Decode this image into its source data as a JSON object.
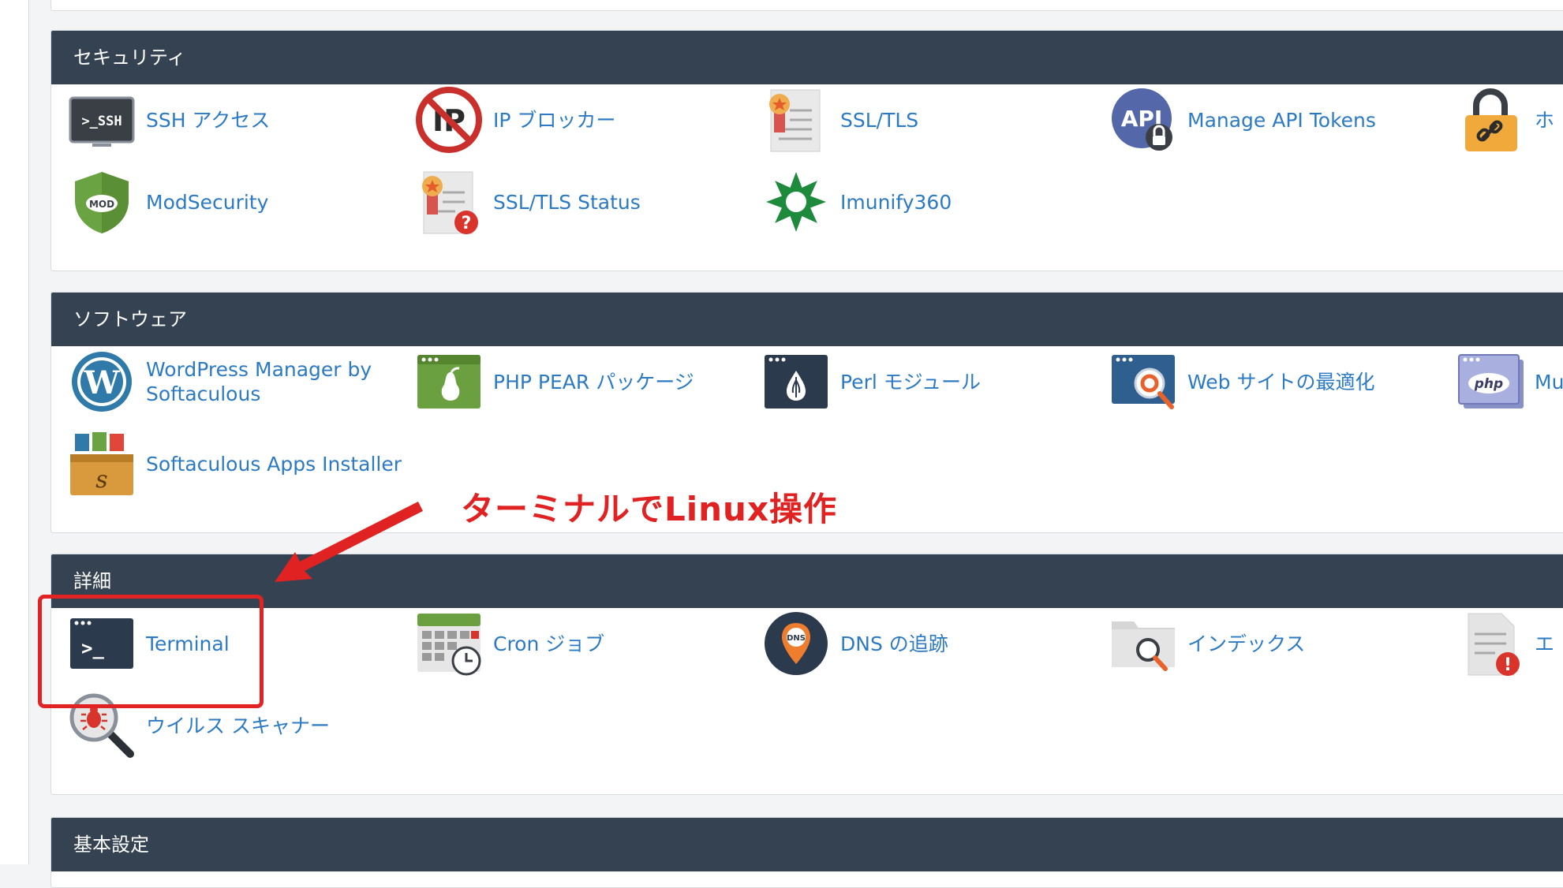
{
  "sections": {
    "security": {
      "title": "セキュリティ",
      "items": [
        {
          "label": "SSH アクセス",
          "icon": "ssh-icon"
        },
        {
          "label": "IP ブロッカー",
          "icon": "ip-blocker-icon"
        },
        {
          "label": "SSL/TLS",
          "icon": "certificate-icon"
        },
        {
          "label": "Manage API Tokens",
          "icon": "api-lock-icon"
        },
        {
          "label": "ホ",
          "icon": "padlock-link-icon"
        },
        {
          "label": "ModSecurity",
          "icon": "mod-shield-icon"
        },
        {
          "label": "SSL/TLS Status",
          "icon": "certificate-status-icon"
        },
        {
          "label": "Imunify360",
          "icon": "imunify-icon"
        }
      ]
    },
    "software": {
      "title": "ソフトウェア",
      "items": [
        {
          "label": "WordPress Manager by Softaculous",
          "icon": "wordpress-icon"
        },
        {
          "label": "PHP PEAR パッケージ",
          "icon": "pear-icon"
        },
        {
          "label": "Perl モジュール",
          "icon": "perl-icon"
        },
        {
          "label": "Web サイトの最適化",
          "icon": "optimize-icon"
        },
        {
          "label": "Mu",
          "icon": "php-icon"
        },
        {
          "label": "Softaculous Apps Installer",
          "icon": "softaculous-icon"
        }
      ]
    },
    "advanced": {
      "title": "詳細",
      "items": [
        {
          "label": "Terminal",
          "icon": "terminal-icon"
        },
        {
          "label": "Cron ジョブ",
          "icon": "calendar-clock-icon"
        },
        {
          "label": "DNS の追跡",
          "icon": "dns-pin-icon"
        },
        {
          "label": "インデックス",
          "icon": "folder-search-icon"
        },
        {
          "label": "エ",
          "icon": "error-doc-icon"
        },
        {
          "label": "ウイルス スキャナー",
          "icon": "virus-scanner-icon"
        }
      ]
    },
    "basic": {
      "title": "基本設定"
    }
  },
  "annotation": {
    "text": "ターミナルでLinux操作"
  },
  "colors": {
    "header_bg": "#354252",
    "link": "#2c7ac4",
    "annotation": "#e02222"
  }
}
